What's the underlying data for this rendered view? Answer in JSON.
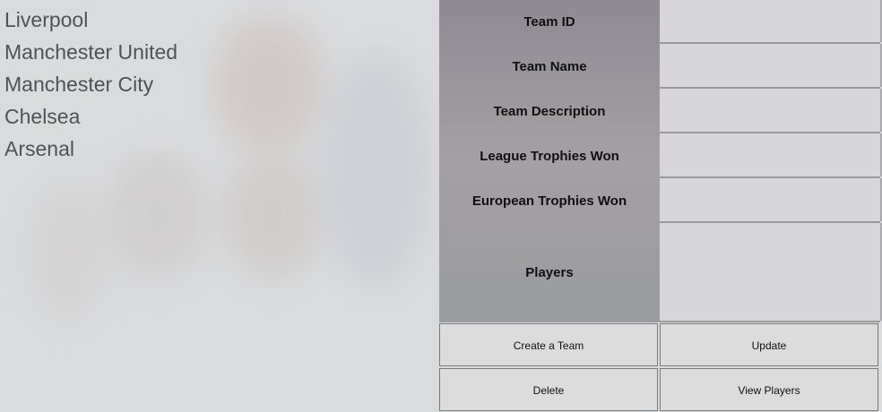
{
  "teams": [
    "Liverpool",
    "Manchester United",
    "Manchester City",
    "Chelsea",
    "Arsenal"
  ],
  "labels": {
    "team_id": "Team ID",
    "team_name": "Team Name",
    "team_description": "Team Description",
    "league_trophies": "League Trophies Won",
    "european_trophies": "European Trophies Won",
    "players": "Players"
  },
  "fields": {
    "team_id": "",
    "team_name": "",
    "team_description": "",
    "league_trophies": "",
    "european_trophies": "",
    "players": ""
  },
  "buttons": {
    "create": "Create a Team",
    "update": "Update",
    "delete": "Delete",
    "view_players": "View Players"
  }
}
